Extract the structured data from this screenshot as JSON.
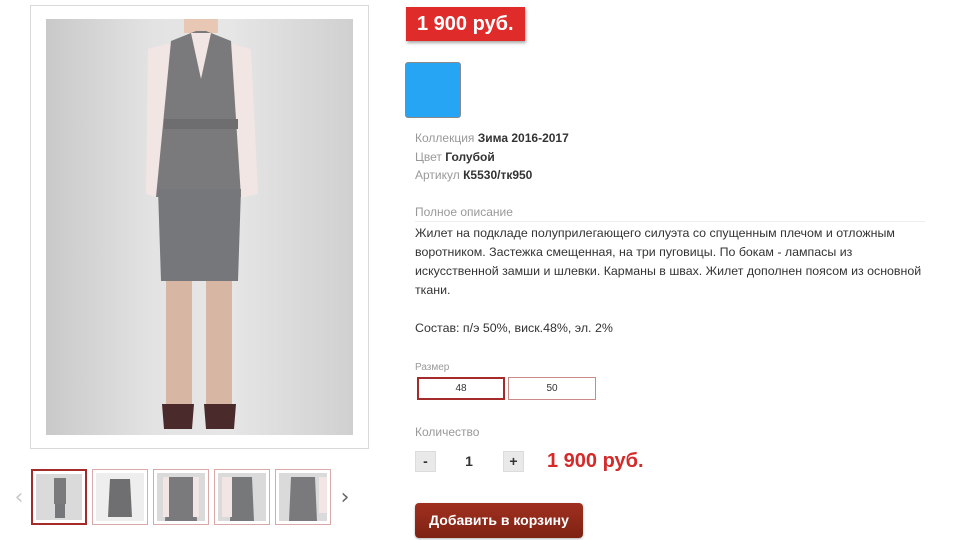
{
  "product": {
    "price_badge": "1 900 руб.",
    "color_swatch_hex": "#27a5f5",
    "photo_alt_icon": "dress-photo"
  },
  "attributes": [
    {
      "key": "Коллекция",
      "value": "Зима 2016-2017"
    },
    {
      "key": "Цвет",
      "value": "Голубой"
    },
    {
      "key": "Артикул",
      "value": "К5530/тк950"
    }
  ],
  "description": {
    "label": "Полное описание",
    "text": "Жилет на подкладе полуприлегающего силуэта со спущенным плечом и отложным воротником. Застежка смещенная, на три пуговицы. По бокам - лампасы из искусственной замши и шлевки. Карманы в швах. Жилет дополнен поясом из основной ткани.",
    "composition": "Состав: п/э 50%, виск.48%, эл. 2%"
  },
  "size": {
    "label": "Размер",
    "options": [
      "48",
      "50"
    ],
    "selected": "48"
  },
  "quantity": {
    "label": "Количество",
    "minus": "-",
    "value": "1",
    "plus": "+",
    "total": "1 900 руб."
  },
  "cart": {
    "button_label": "Добавить в корзину"
  },
  "gallery": {
    "prev": "‹",
    "next": "›",
    "thumbnail_count": 5,
    "active_index": 0
  }
}
